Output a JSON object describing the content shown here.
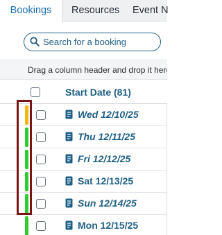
{
  "tabs": [
    {
      "label": "Bookings",
      "active": true
    },
    {
      "label": "Resources",
      "active": false
    },
    {
      "label": "Event N",
      "active": false
    }
  ],
  "search": {
    "placeholder": "Search for a booking",
    "icon": "search-icon"
  },
  "group_hint": "Drag a column header and drop it here to group by that column",
  "grid": {
    "header": {
      "title": "Start Date (81)"
    },
    "rows": [
      {
        "date": "Wed 12/10/25",
        "status_color": "#f5b512",
        "italic": true
      },
      {
        "date": "Thu 12/11/25",
        "status_color": "#2ecc2e",
        "italic": true
      },
      {
        "date": "Fri 12/12/25",
        "status_color": "#2ecc2e",
        "italic": true
      },
      {
        "date": "Sat 12/13/25",
        "status_color": "#2ecc2e",
        "italic": false
      },
      {
        "date": "Sun 12/14/25",
        "status_color": "#2ecc2e",
        "italic": true
      },
      {
        "date": "Mon 12/15/25",
        "status_color": "#2ecc2e",
        "italic": false
      }
    ]
  },
  "colors": {
    "accent": "#1d5f86",
    "highlight": "#7b1414"
  }
}
